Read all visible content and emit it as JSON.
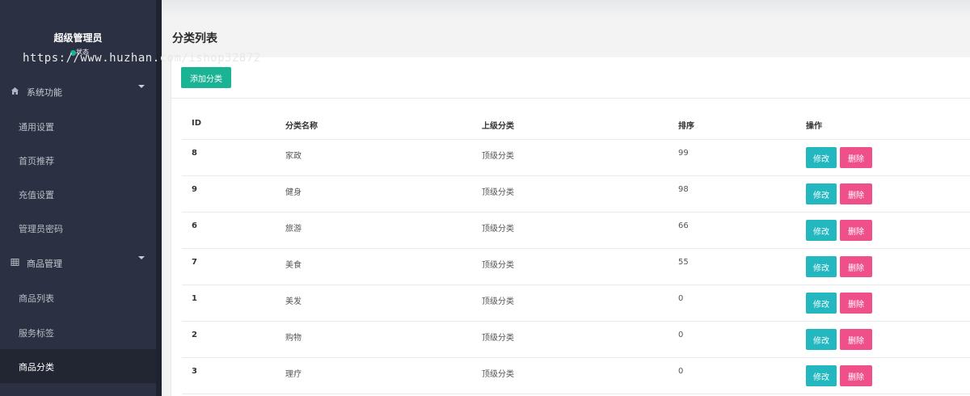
{
  "profile": {
    "admin_name": "超级管理员",
    "status": "状态"
  },
  "watermark": "https://www.huzhan.com/ishop32872",
  "sidebar": {
    "groups": [
      {
        "label": "系统功能",
        "icon": "home-icon"
      },
      {
        "label": "商品管理",
        "icon": "table-icon"
      }
    ],
    "items": [
      {
        "label": "通用设置"
      },
      {
        "label": "首页推荐"
      },
      {
        "label": "充值设置"
      },
      {
        "label": "管理员密码"
      },
      {
        "label": "商品列表"
      },
      {
        "label": "服务标签"
      },
      {
        "label": "商品分类"
      }
    ]
  },
  "header": {
    "title": "分类列表"
  },
  "toolbar": {
    "add_label": "添加分类"
  },
  "table": {
    "columns": [
      "ID",
      "分类名称",
      "上级分类",
      "排序",
      "操作"
    ],
    "edit_label": "修改",
    "delete_label": "删除",
    "rows": [
      {
        "id": "8",
        "name": "家政",
        "parent": "顶级分类",
        "sort": "99"
      },
      {
        "id": "9",
        "name": "健身",
        "parent": "顶级分类",
        "sort": "98"
      },
      {
        "id": "6",
        "name": "旅游",
        "parent": "顶级分类",
        "sort": "66"
      },
      {
        "id": "7",
        "name": "美食",
        "parent": "顶级分类",
        "sort": "55"
      },
      {
        "id": "1",
        "name": "美发",
        "parent": "顶级分类",
        "sort": "0"
      },
      {
        "id": "2",
        "name": "购物",
        "parent": "顶级分类",
        "sort": "0"
      },
      {
        "id": "3",
        "name": "理疗",
        "parent": "顶级分类",
        "sort": "0"
      }
    ]
  },
  "colors": {
    "accent": "#1ab394",
    "edit": "#23b7c0",
    "delete": "#f0508a",
    "sidebar": "#2b3142"
  }
}
